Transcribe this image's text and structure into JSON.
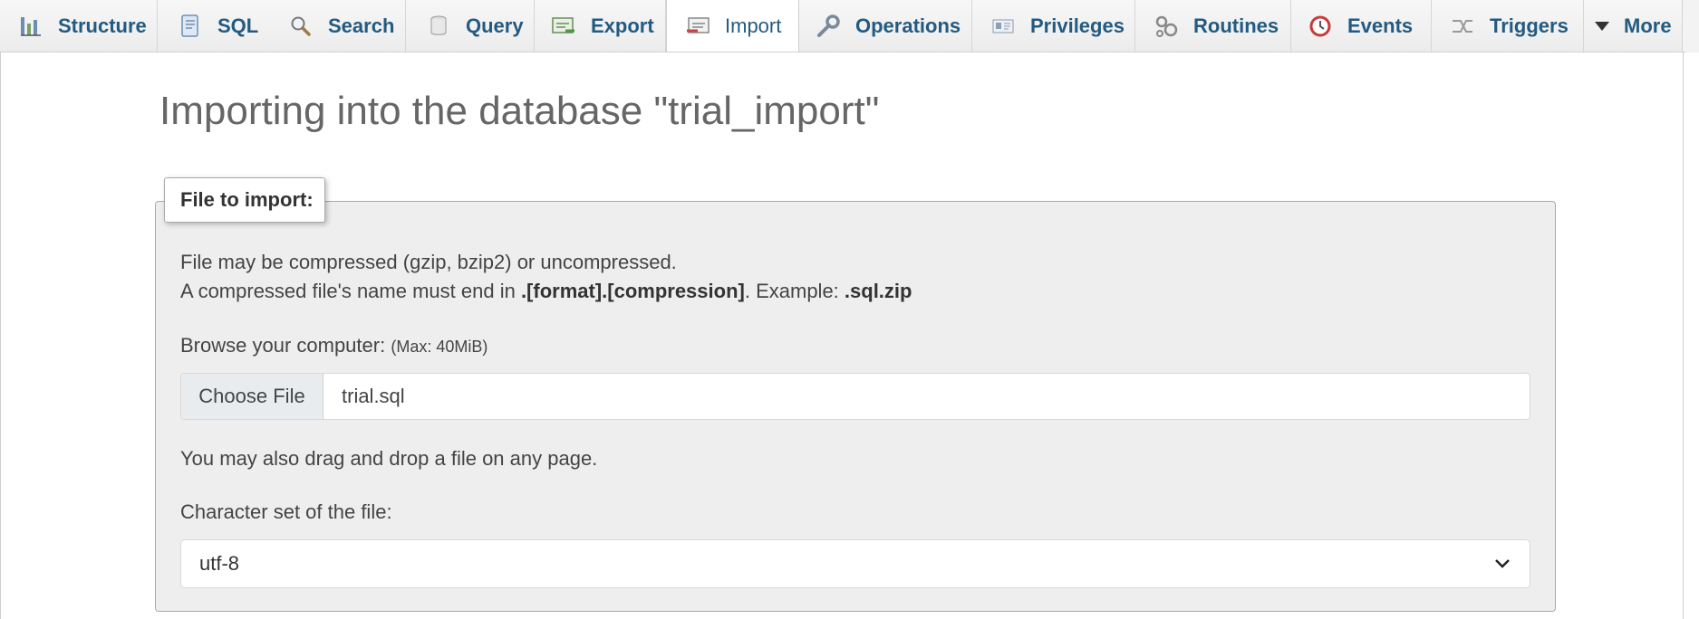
{
  "tabs": [
    {
      "label": "Structure",
      "icon": "structure-icon"
    },
    {
      "label": "SQL",
      "icon": "sql-icon"
    },
    {
      "label": "Search",
      "icon": "search-icon"
    },
    {
      "label": "Query",
      "icon": "query-icon"
    },
    {
      "label": "Export",
      "icon": "export-icon"
    },
    {
      "label": "Import",
      "icon": "import-icon",
      "active": true
    },
    {
      "label": "Operations",
      "icon": "wrench-icon"
    },
    {
      "label": "Privileges",
      "icon": "privileges-icon"
    },
    {
      "label": "Routines",
      "icon": "routines-icon"
    },
    {
      "label": "Events",
      "icon": "clock-icon"
    },
    {
      "label": "Triggers",
      "icon": "triggers-icon"
    },
    {
      "label": "More",
      "icon": "caret-down-icon"
    }
  ],
  "colors": {
    "tab_text": "#235a81",
    "fieldset_bg": "#eeeeee",
    "title": "#666666"
  },
  "page": {
    "title": "Importing into the database \"trial_import\""
  },
  "import_form": {
    "legend": "File to import:",
    "compress_note": "File may be compressed (gzip, bzip2) or uncompressed.",
    "name_note_prefix": "A compressed file's name must end in ",
    "name_note_format": ".[format].[compression]",
    "name_note_mid": ". Example: ",
    "name_note_example": ".sql.zip",
    "browse_label": "Browse your computer:",
    "max_size": "(Max: 40MiB)",
    "choose_file_label": "Choose File",
    "file_name": "trial.sql",
    "drag_drop_note": "You may also drag and drop a file on any page.",
    "charset_label": "Character set of the file:",
    "charset_value": "utf-8"
  }
}
